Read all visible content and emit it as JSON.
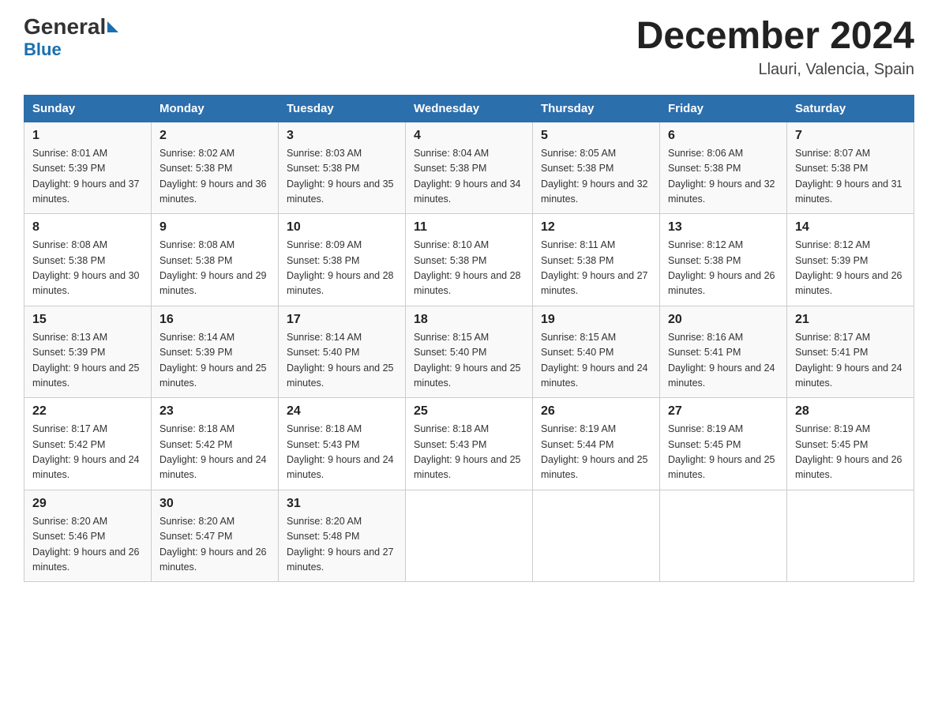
{
  "header": {
    "logo_general": "General",
    "logo_blue": "Blue",
    "title": "December 2024",
    "subtitle": "Llauri, Valencia, Spain"
  },
  "days_of_week": [
    "Sunday",
    "Monday",
    "Tuesday",
    "Wednesday",
    "Thursday",
    "Friday",
    "Saturday"
  ],
  "weeks": [
    [
      {
        "day": "1",
        "sunrise": "8:01 AM",
        "sunset": "5:39 PM",
        "daylight": "9 hours and 37 minutes."
      },
      {
        "day": "2",
        "sunrise": "8:02 AM",
        "sunset": "5:38 PM",
        "daylight": "9 hours and 36 minutes."
      },
      {
        "day": "3",
        "sunrise": "8:03 AM",
        "sunset": "5:38 PM",
        "daylight": "9 hours and 35 minutes."
      },
      {
        "day": "4",
        "sunrise": "8:04 AM",
        "sunset": "5:38 PM",
        "daylight": "9 hours and 34 minutes."
      },
      {
        "day": "5",
        "sunrise": "8:05 AM",
        "sunset": "5:38 PM",
        "daylight": "9 hours and 32 minutes."
      },
      {
        "day": "6",
        "sunrise": "8:06 AM",
        "sunset": "5:38 PM",
        "daylight": "9 hours and 32 minutes."
      },
      {
        "day": "7",
        "sunrise": "8:07 AM",
        "sunset": "5:38 PM",
        "daylight": "9 hours and 31 minutes."
      }
    ],
    [
      {
        "day": "8",
        "sunrise": "8:08 AM",
        "sunset": "5:38 PM",
        "daylight": "9 hours and 30 minutes."
      },
      {
        "day": "9",
        "sunrise": "8:08 AM",
        "sunset": "5:38 PM",
        "daylight": "9 hours and 29 minutes."
      },
      {
        "day": "10",
        "sunrise": "8:09 AM",
        "sunset": "5:38 PM",
        "daylight": "9 hours and 28 minutes."
      },
      {
        "day": "11",
        "sunrise": "8:10 AM",
        "sunset": "5:38 PM",
        "daylight": "9 hours and 28 minutes."
      },
      {
        "day": "12",
        "sunrise": "8:11 AM",
        "sunset": "5:38 PM",
        "daylight": "9 hours and 27 minutes."
      },
      {
        "day": "13",
        "sunrise": "8:12 AM",
        "sunset": "5:38 PM",
        "daylight": "9 hours and 26 minutes."
      },
      {
        "day": "14",
        "sunrise": "8:12 AM",
        "sunset": "5:39 PM",
        "daylight": "9 hours and 26 minutes."
      }
    ],
    [
      {
        "day": "15",
        "sunrise": "8:13 AM",
        "sunset": "5:39 PM",
        "daylight": "9 hours and 25 minutes."
      },
      {
        "day": "16",
        "sunrise": "8:14 AM",
        "sunset": "5:39 PM",
        "daylight": "9 hours and 25 minutes."
      },
      {
        "day": "17",
        "sunrise": "8:14 AM",
        "sunset": "5:40 PM",
        "daylight": "9 hours and 25 minutes."
      },
      {
        "day": "18",
        "sunrise": "8:15 AM",
        "sunset": "5:40 PM",
        "daylight": "9 hours and 25 minutes."
      },
      {
        "day": "19",
        "sunrise": "8:15 AM",
        "sunset": "5:40 PM",
        "daylight": "9 hours and 24 minutes."
      },
      {
        "day": "20",
        "sunrise": "8:16 AM",
        "sunset": "5:41 PM",
        "daylight": "9 hours and 24 minutes."
      },
      {
        "day": "21",
        "sunrise": "8:17 AM",
        "sunset": "5:41 PM",
        "daylight": "9 hours and 24 minutes."
      }
    ],
    [
      {
        "day": "22",
        "sunrise": "8:17 AM",
        "sunset": "5:42 PM",
        "daylight": "9 hours and 24 minutes."
      },
      {
        "day": "23",
        "sunrise": "8:18 AM",
        "sunset": "5:42 PM",
        "daylight": "9 hours and 24 minutes."
      },
      {
        "day": "24",
        "sunrise": "8:18 AM",
        "sunset": "5:43 PM",
        "daylight": "9 hours and 24 minutes."
      },
      {
        "day": "25",
        "sunrise": "8:18 AM",
        "sunset": "5:43 PM",
        "daylight": "9 hours and 25 minutes."
      },
      {
        "day": "26",
        "sunrise": "8:19 AM",
        "sunset": "5:44 PM",
        "daylight": "9 hours and 25 minutes."
      },
      {
        "day": "27",
        "sunrise": "8:19 AM",
        "sunset": "5:45 PM",
        "daylight": "9 hours and 25 minutes."
      },
      {
        "day": "28",
        "sunrise": "8:19 AM",
        "sunset": "5:45 PM",
        "daylight": "9 hours and 26 minutes."
      }
    ],
    [
      {
        "day": "29",
        "sunrise": "8:20 AM",
        "sunset": "5:46 PM",
        "daylight": "9 hours and 26 minutes."
      },
      {
        "day": "30",
        "sunrise": "8:20 AM",
        "sunset": "5:47 PM",
        "daylight": "9 hours and 26 minutes."
      },
      {
        "day": "31",
        "sunrise": "8:20 AM",
        "sunset": "5:48 PM",
        "daylight": "9 hours and 27 minutes."
      },
      null,
      null,
      null,
      null
    ]
  ]
}
